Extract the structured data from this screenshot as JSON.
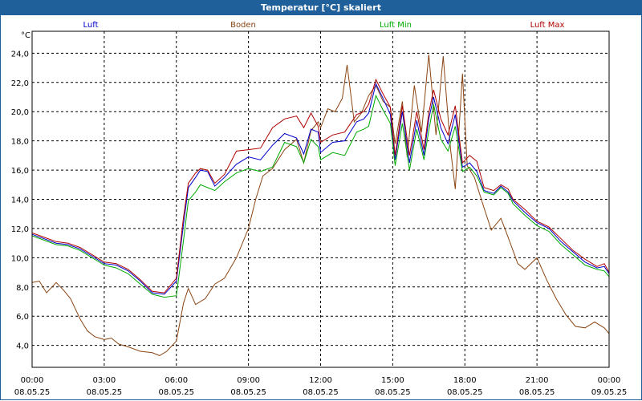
{
  "window": {
    "title": "Temperatur [°C] skaliert"
  },
  "chart_data": {
    "type": "line",
    "title": "Temperatur [°C] skaliert",
    "ylabel": "°C",
    "xlabel": "",
    "ylim": [
      2.5,
      25.5
    ],
    "xlim": [
      0,
      24
    ],
    "grid": true,
    "legend_position": "top",
    "y_ticks": [
      "4,0",
      "6,0",
      "8,0",
      "10,0",
      "12,0",
      "14,0",
      "16,0",
      "18,0",
      "20,0",
      "22,0",
      "24,0"
    ],
    "x_ticks": [
      {
        "time": "00:00",
        "date": "08.05.25"
      },
      {
        "time": "03:00",
        "date": "08.05.25"
      },
      {
        "time": "06:00",
        "date": "08.05.25"
      },
      {
        "time": "09:00",
        "date": "08.05.25"
      },
      {
        "time": "12:00",
        "date": "08.05.25"
      },
      {
        "time": "15:00",
        "date": "08.05.25"
      },
      {
        "time": "18:00",
        "date": "08.05.25"
      },
      {
        "time": "21:00",
        "date": "08.05.25"
      },
      {
        "time": "00:00",
        "date": "09.05.25"
      }
    ],
    "series": [
      {
        "name": "Luft",
        "color": "#0000cc",
        "points": [
          [
            0,
            11.6
          ],
          [
            0.5,
            11.3
          ],
          [
            1,
            11.0
          ],
          [
            1.5,
            10.9
          ],
          [
            2,
            10.6
          ],
          [
            2.5,
            10.1
          ],
          [
            3,
            9.6
          ],
          [
            3.5,
            9.5
          ],
          [
            4,
            9.1
          ],
          [
            4.5,
            8.4
          ],
          [
            5,
            7.6
          ],
          [
            5.5,
            7.5
          ],
          [
            6,
            8.4
          ],
          [
            6.3,
            12.3
          ],
          [
            6.5,
            14.8
          ],
          [
            6.8,
            15.5
          ],
          [
            7,
            16.0
          ],
          [
            7.3,
            15.9
          ],
          [
            7.6,
            14.9
          ],
          [
            8,
            15.5
          ],
          [
            8.5,
            16.4
          ],
          [
            9,
            16.9
          ],
          [
            9.5,
            16.7
          ],
          [
            10,
            17.7
          ],
          [
            10.5,
            18.5
          ],
          [
            11,
            18.2
          ],
          [
            11.3,
            17.1
          ],
          [
            11.6,
            18.8
          ],
          [
            11.9,
            18.6
          ],
          [
            12,
            17.2
          ],
          [
            12.5,
            17.9
          ],
          [
            13,
            18.0
          ],
          [
            13.5,
            19.3
          ],
          [
            13.8,
            19.5
          ],
          [
            14,
            19.9
          ],
          [
            14.3,
            21.9
          ],
          [
            14.6,
            20.9
          ],
          [
            14.9,
            19.8
          ],
          [
            15.1,
            16.7
          ],
          [
            15.4,
            20.0
          ],
          [
            15.7,
            16.5
          ],
          [
            16,
            19.4
          ],
          [
            16.3,
            17.0
          ],
          [
            16.5,
            19.5
          ],
          [
            16.7,
            21.0
          ],
          [
            17,
            18.9
          ],
          [
            17.3,
            17.8
          ],
          [
            17.6,
            19.8
          ],
          [
            17.9,
            16.2
          ],
          [
            18.2,
            16.5
          ],
          [
            18.5,
            15.9
          ],
          [
            18.8,
            14.6
          ],
          [
            19.2,
            14.4
          ],
          [
            19.5,
            14.9
          ],
          [
            19.8,
            14.5
          ],
          [
            20,
            13.9
          ],
          [
            20.5,
            13.1
          ],
          [
            21,
            12.4
          ],
          [
            21.5,
            12.0
          ],
          [
            22,
            11.1
          ],
          [
            22.5,
            10.4
          ],
          [
            23,
            9.7
          ],
          [
            23.5,
            9.3
          ],
          [
            23.8,
            9.4
          ],
          [
            24,
            8.9
          ]
        ]
      },
      {
        "name": "Boden",
        "color": "#8b4513",
        "points": [
          [
            0,
            8.3
          ],
          [
            0.3,
            8.4
          ],
          [
            0.6,
            7.6
          ],
          [
            1,
            8.3
          ],
          [
            1.3,
            7.8
          ],
          [
            1.6,
            7.2
          ],
          [
            2,
            5.8
          ],
          [
            2.3,
            5.0
          ],
          [
            2.6,
            4.6
          ],
          [
            3,
            4.4
          ],
          [
            3.3,
            4.5
          ],
          [
            3.6,
            4.1
          ],
          [
            4,
            3.9
          ],
          [
            4.5,
            3.6
          ],
          [
            5,
            3.5
          ],
          [
            5.3,
            3.3
          ],
          [
            5.6,
            3.6
          ],
          [
            6,
            4.3
          ],
          [
            6.3,
            6.9
          ],
          [
            6.5,
            7.9
          ],
          [
            6.8,
            6.8
          ],
          [
            7.2,
            7.2
          ],
          [
            7.6,
            8.2
          ],
          [
            8,
            8.6
          ],
          [
            8.5,
            10.0
          ],
          [
            9,
            12.0
          ],
          [
            9.3,
            14.0
          ],
          [
            9.6,
            15.6
          ],
          [
            10,
            16.1
          ],
          [
            10.5,
            17.4
          ],
          [
            11,
            18.1
          ],
          [
            11.3,
            16.5
          ],
          [
            11.6,
            18.7
          ],
          [
            11.9,
            19.3
          ],
          [
            12,
            18.9
          ],
          [
            12.3,
            20.2
          ],
          [
            12.6,
            20.0
          ],
          [
            12.9,
            20.9
          ],
          [
            13.1,
            23.2
          ],
          [
            13.4,
            19.3
          ],
          [
            13.7,
            19.9
          ],
          [
            14,
            21.1
          ],
          [
            14.3,
            21.8
          ],
          [
            14.6,
            20.7
          ],
          [
            14.9,
            20.3
          ],
          [
            15.1,
            17.8
          ],
          [
            15.4,
            20.7
          ],
          [
            15.6,
            16.9
          ],
          [
            15.9,
            21.8
          ],
          [
            16.2,
            18.6
          ],
          [
            16.5,
            23.9
          ],
          [
            16.8,
            18.4
          ],
          [
            17.1,
            23.8
          ],
          [
            17.4,
            17.5
          ],
          [
            17.6,
            14.7
          ],
          [
            17.9,
            22.6
          ],
          [
            18.1,
            16.3
          ],
          [
            18.4,
            15.5
          ],
          [
            18.8,
            13.4
          ],
          [
            19.1,
            11.9
          ],
          [
            19.5,
            12.7
          ],
          [
            19.8,
            11.4
          ],
          [
            20.2,
            9.6
          ],
          [
            20.5,
            9.2
          ],
          [
            21,
            10.0
          ],
          [
            21.4,
            8.5
          ],
          [
            21.8,
            7.2
          ],
          [
            22.2,
            6.1
          ],
          [
            22.6,
            5.3
          ],
          [
            23,
            5.2
          ],
          [
            23.4,
            5.6
          ],
          [
            23.8,
            5.2
          ],
          [
            24,
            4.8
          ]
        ]
      },
      {
        "name": "Luft Min",
        "color": "#00aa00",
        "points": [
          [
            0,
            11.5
          ],
          [
            0.5,
            11.2
          ],
          [
            1,
            10.9
          ],
          [
            1.5,
            10.8
          ],
          [
            2,
            10.5
          ],
          [
            2.5,
            10.0
          ],
          [
            3,
            9.5
          ],
          [
            3.5,
            9.3
          ],
          [
            4,
            8.9
          ],
          [
            4.5,
            8.2
          ],
          [
            5,
            7.5
          ],
          [
            5.5,
            7.3
          ],
          [
            6,
            7.4
          ],
          [
            6.3,
            11.2
          ],
          [
            6.5,
            13.9
          ],
          [
            6.8,
            14.5
          ],
          [
            7,
            15.0
          ],
          [
            7.3,
            14.8
          ],
          [
            7.6,
            14.6
          ],
          [
            8,
            15.2
          ],
          [
            8.5,
            15.8
          ],
          [
            9,
            16.1
          ],
          [
            9.5,
            15.9
          ],
          [
            10,
            16.2
          ],
          [
            10.5,
            17.9
          ],
          [
            11,
            17.6
          ],
          [
            11.3,
            16.5
          ],
          [
            11.6,
            18.1
          ],
          [
            11.9,
            17.6
          ],
          [
            12,
            16.7
          ],
          [
            12.5,
            17.2
          ],
          [
            13,
            17.0
          ],
          [
            13.5,
            18.6
          ],
          [
            13.8,
            18.8
          ],
          [
            14,
            19.0
          ],
          [
            14.3,
            21.1
          ],
          [
            14.6,
            20.1
          ],
          [
            14.9,
            19.2
          ],
          [
            15.1,
            16.3
          ],
          [
            15.4,
            19.2
          ],
          [
            15.7,
            16.0
          ],
          [
            16,
            18.8
          ],
          [
            16.3,
            16.7
          ],
          [
            16.5,
            18.7
          ],
          [
            16.7,
            20.5
          ],
          [
            17,
            18.1
          ],
          [
            17.3,
            17.3
          ],
          [
            17.6,
            19.0
          ],
          [
            17.9,
            15.9
          ],
          [
            18.2,
            16.2
          ],
          [
            18.5,
            15.6
          ],
          [
            18.8,
            14.5
          ],
          [
            19.2,
            14.3
          ],
          [
            19.5,
            14.8
          ],
          [
            19.8,
            14.4
          ],
          [
            20,
            13.7
          ],
          [
            20.5,
            12.9
          ],
          [
            21,
            12.2
          ],
          [
            21.5,
            11.8
          ],
          [
            22,
            10.9
          ],
          [
            22.5,
            10.2
          ],
          [
            23,
            9.5
          ],
          [
            23.5,
            9.2
          ],
          [
            23.8,
            9.1
          ],
          [
            24,
            8.7
          ]
        ]
      },
      {
        "name": "Luft Max",
        "color": "#b00000",
        "points": [
          [
            0,
            11.7
          ],
          [
            0.5,
            11.4
          ],
          [
            1,
            11.1
          ],
          [
            1.5,
            11.0
          ],
          [
            2,
            10.7
          ],
          [
            2.5,
            10.2
          ],
          [
            3,
            9.7
          ],
          [
            3.5,
            9.6
          ],
          [
            4,
            9.2
          ],
          [
            4.5,
            8.5
          ],
          [
            5,
            7.7
          ],
          [
            5.5,
            7.6
          ],
          [
            6,
            8.6
          ],
          [
            6.3,
            12.8
          ],
          [
            6.5,
            15.1
          ],
          [
            6.8,
            15.8
          ],
          [
            7,
            16.1
          ],
          [
            7.3,
            16.0
          ],
          [
            7.6,
            15.1
          ],
          [
            8,
            15.7
          ],
          [
            8.5,
            17.3
          ],
          [
            9,
            17.4
          ],
          [
            9.5,
            17.5
          ],
          [
            10,
            18.9
          ],
          [
            10.5,
            19.5
          ],
          [
            11,
            19.7
          ],
          [
            11.3,
            18.9
          ],
          [
            11.6,
            19.9
          ],
          [
            11.9,
            19.0
          ],
          [
            12,
            17.9
          ],
          [
            12.5,
            18.4
          ],
          [
            13,
            18.6
          ],
          [
            13.5,
            19.8
          ],
          [
            13.8,
            20.0
          ],
          [
            14,
            20.5
          ],
          [
            14.3,
            22.2
          ],
          [
            14.6,
            21.2
          ],
          [
            14.9,
            20.3
          ],
          [
            15.1,
            17.0
          ],
          [
            15.4,
            20.4
          ],
          [
            15.7,
            17.0
          ],
          [
            16,
            20.0
          ],
          [
            16.3,
            17.4
          ],
          [
            16.5,
            19.9
          ],
          [
            16.7,
            21.5
          ],
          [
            17,
            19.5
          ],
          [
            17.3,
            18.4
          ],
          [
            17.6,
            20.4
          ],
          [
            17.9,
            16.5
          ],
          [
            18.2,
            17.0
          ],
          [
            18.5,
            16.6
          ],
          [
            18.8,
            14.8
          ],
          [
            19.2,
            14.6
          ],
          [
            19.5,
            15.0
          ],
          [
            19.8,
            14.7
          ],
          [
            20,
            14.0
          ],
          [
            20.5,
            13.3
          ],
          [
            21,
            12.5
          ],
          [
            21.5,
            12.1
          ],
          [
            22,
            11.3
          ],
          [
            22.5,
            10.5
          ],
          [
            23,
            9.9
          ],
          [
            23.5,
            9.4
          ],
          [
            23.8,
            9.6
          ],
          [
            24,
            9.0
          ]
        ]
      }
    ]
  }
}
